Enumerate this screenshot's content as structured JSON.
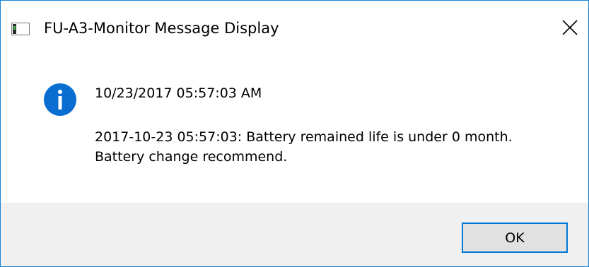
{
  "window": {
    "title": "FU-A3-Monitor Message Display",
    "icon": "application-window-icon",
    "close_icon": "close-icon"
  },
  "message": {
    "icon": "information-icon",
    "timestamp": "10/23/2017 05:57:03 AM",
    "line1": "2017-10-23 05:57:03: Battery remained life is under 0 month.",
    "line2": "Battery change recommend."
  },
  "buttons": {
    "ok_label": "OK"
  },
  "colors": {
    "accent": "#0078d7",
    "info_icon": "#0a6ed1",
    "footer_bg": "#f0f0f0",
    "button_bg": "#e1e1e1"
  }
}
